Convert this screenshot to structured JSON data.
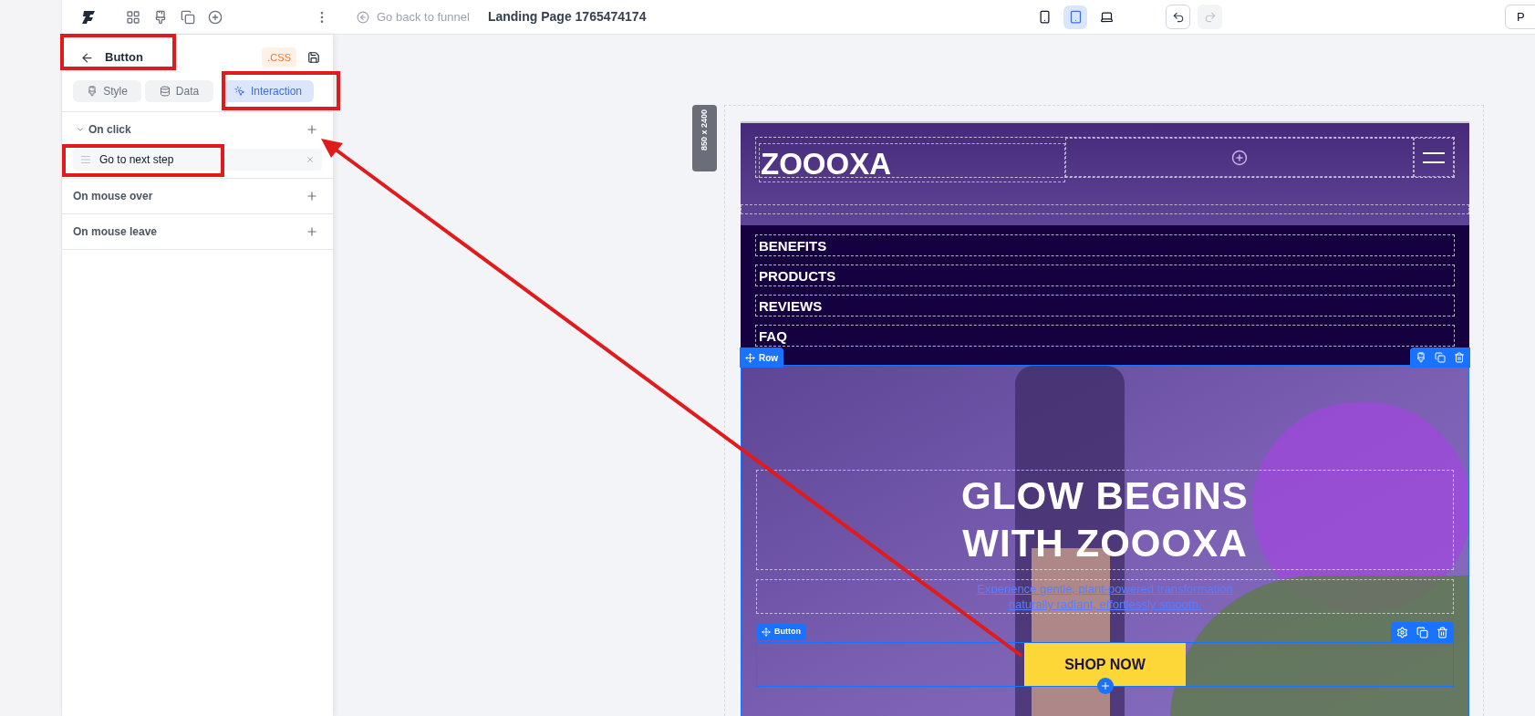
{
  "toolbar": {
    "back_link": "Go back to funnel",
    "page_title": "Landing Page 1765474174",
    "devices": [
      {
        "kind": "mobile",
        "selected": false
      },
      {
        "kind": "tablet",
        "selected": true
      },
      {
        "kind": "desktop",
        "selected": false
      }
    ],
    "undo_enabled": true,
    "redo_enabled": false,
    "right_button": "P"
  },
  "panel": {
    "title": "Button",
    "css_badge": ".CSS",
    "tabs": [
      {
        "label": "Style",
        "kind": "style",
        "selected": false
      },
      {
        "label": "Data",
        "kind": "data",
        "selected": false
      },
      {
        "label": "Interaction",
        "kind": "interaction",
        "selected": true
      }
    ],
    "events": [
      {
        "label": "On click",
        "expanded": true,
        "actions": [
          "Go to next step"
        ]
      },
      {
        "label": "On mouse over",
        "expanded": false
      },
      {
        "label": "On mouse leave",
        "expanded": false
      }
    ]
  },
  "canvas": {
    "size_badge": "850 x 2400",
    "brand": "ZOOOXA",
    "nav": [
      "BENEFITS",
      "PRODUCTS",
      "REVIEWS",
      "FAQ"
    ],
    "row_label": "Row",
    "hero": {
      "headline": [
        "GLOW BEGINS",
        "WITH ZOOOXA"
      ],
      "subtext": [
        "Experience gentle, plant-powered transformation",
        "naturally radiant, effortlessly smooth."
      ],
      "element_label": "Button",
      "cta": "SHOP NOW"
    }
  }
}
